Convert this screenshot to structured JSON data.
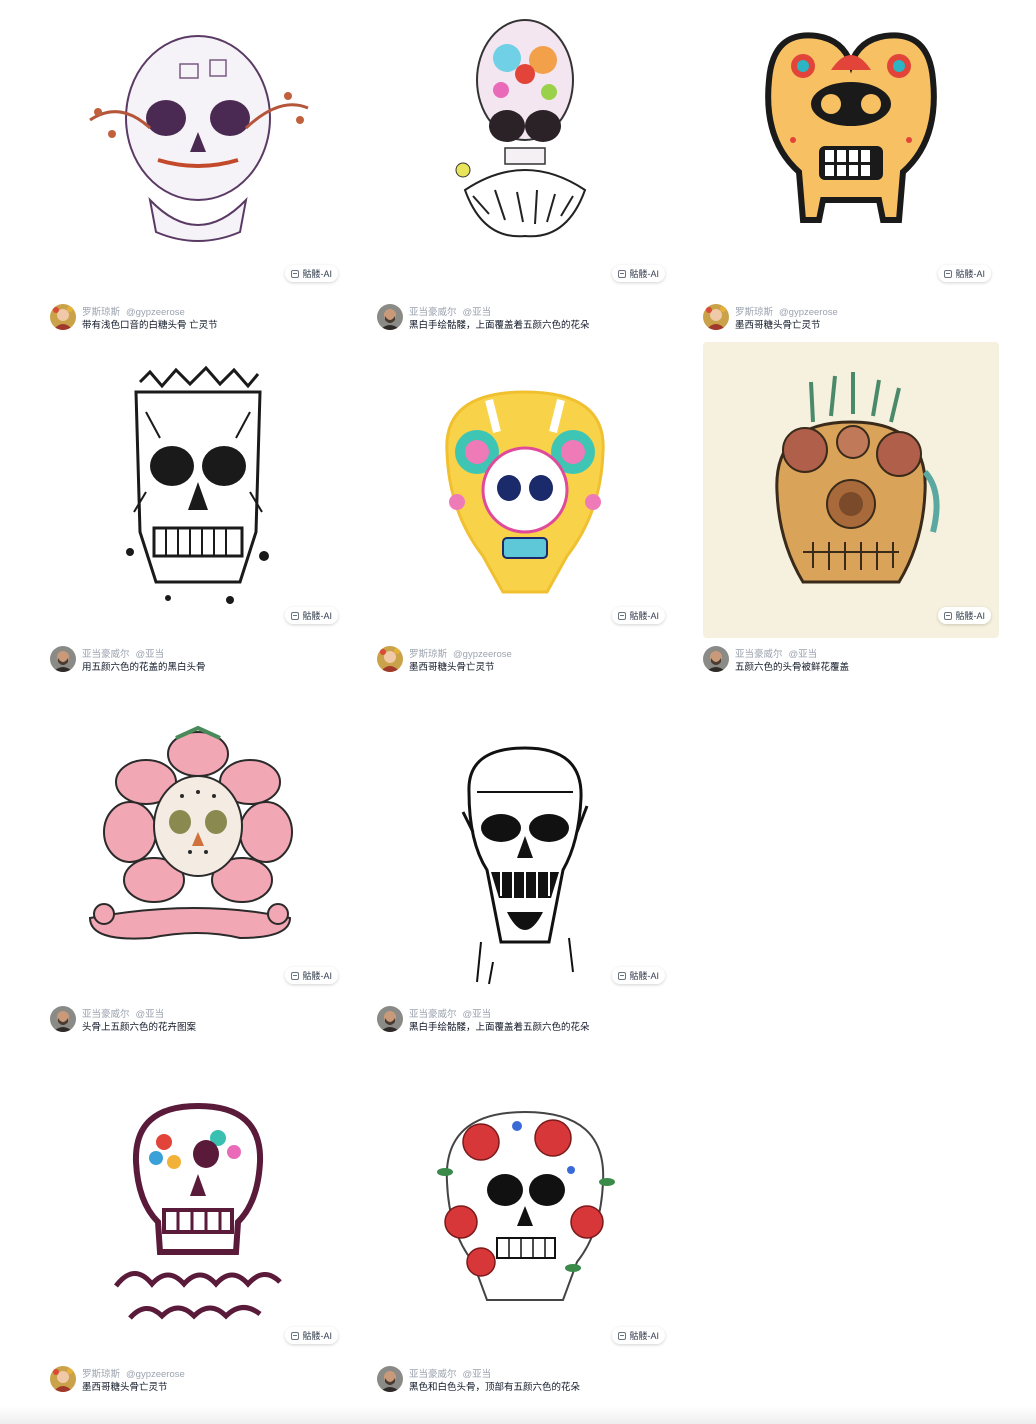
{
  "badge_label": "骷髅-AI",
  "cards": [
    {
      "author": "罗斯琼斯",
      "handle": "@gypzeerose",
      "caption": "带有浅色口音的白糖头骨 亡灵节",
      "avatar": "rose"
    },
    {
      "author": "亚当豪威尔",
      "handle": "@亚当",
      "caption": "黑白手绘骷髅，上面覆盖着五颜六色的花朵",
      "avatar": "adam"
    },
    {
      "author": "罗斯琼斯",
      "handle": "@gypzeerose",
      "caption": "墨西哥糖头骨亡灵节",
      "avatar": "rose"
    },
    {
      "author": "亚当豪威尔",
      "handle": "@亚当",
      "caption": "用五颜六色的花盖的黑白头骨",
      "avatar": "adam"
    },
    {
      "author": "罗斯琼斯",
      "handle": "@gypzeerose",
      "caption": "墨西哥糖头骨亡灵节",
      "avatar": "rose"
    },
    {
      "author": "亚当豪威尔",
      "handle": "@亚当",
      "caption": "五颜六色的头骨被鲜花覆盖",
      "avatar": "adam"
    },
    {
      "author": "亚当豪威尔",
      "handle": "@亚当",
      "caption": "头骨上五颜六色的花卉图案",
      "avatar": "adam"
    },
    {
      "author": "亚当豪威尔",
      "handle": "@亚当",
      "caption": "黑白手绘骷髅，上面覆盖着五颜六色的花朵",
      "avatar": "adam"
    },
    {
      "author": "罗斯琼斯",
      "handle": "@gypzeerose",
      "caption": "墨西哥糖头骨亡灵节",
      "avatar": "rose"
    },
    {
      "author": "亚当豪威尔",
      "handle": "@亚当",
      "caption": "黑色和白色头骨，顶部有五颜六色的花朵",
      "avatar": "adam"
    }
  ]
}
